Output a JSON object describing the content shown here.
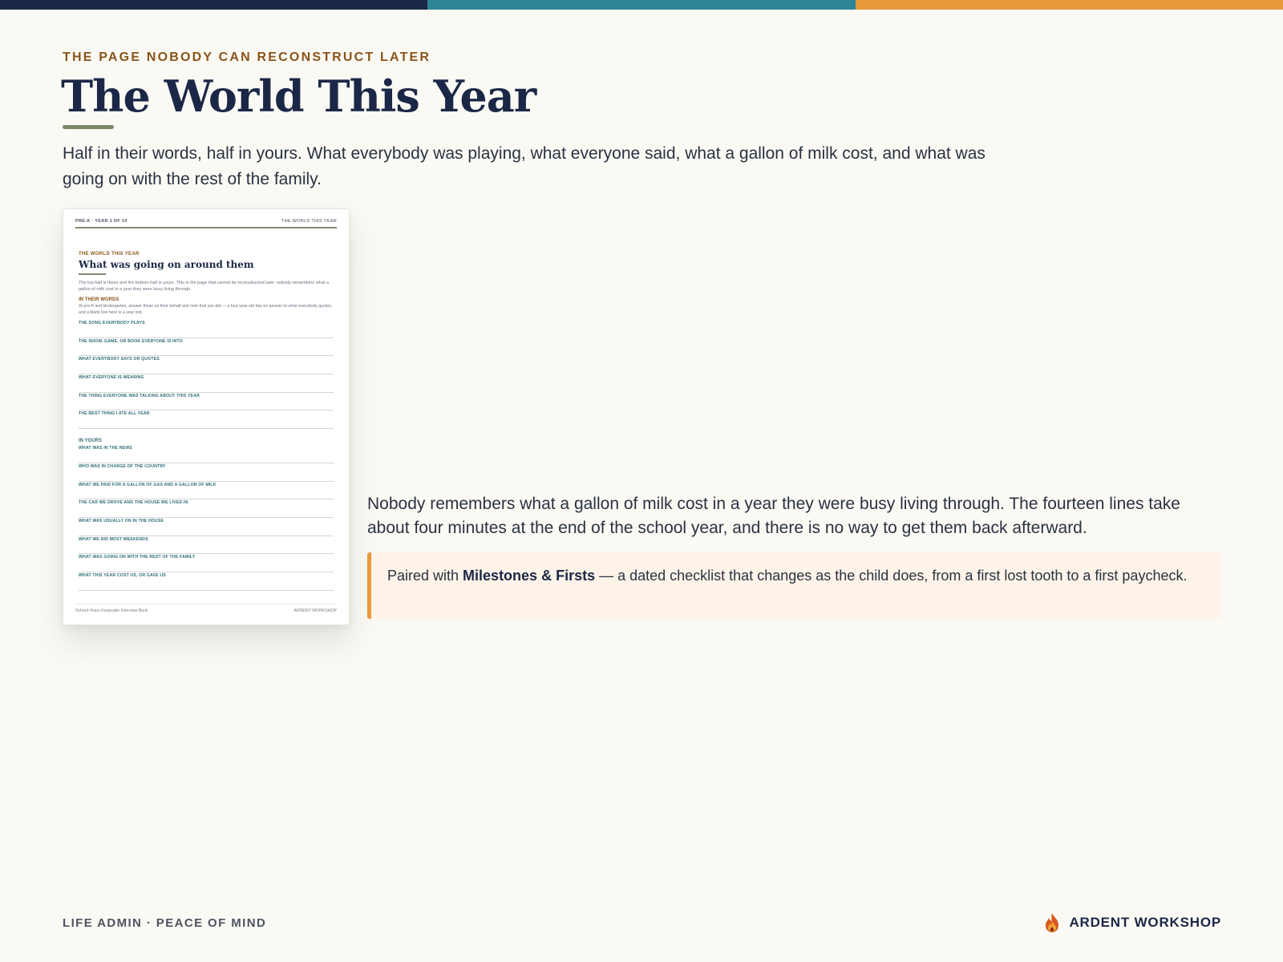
{
  "colors": {
    "bar_navy": "#1b2746",
    "bar_teal": "#2f8496",
    "bar_orange": "#e8993c",
    "kicker": "#8a5418",
    "accent_rule": "#7c8a6a"
  },
  "header": {
    "kicker": "THE PAGE NOBODY CAN RECONSTRUCT LATER",
    "title": "The World This Year",
    "lede": "Half in their words, half in yours. What everybody was playing, what everyone said, what a gallon of milk cost, and what was going on with the rest of the family."
  },
  "preview": {
    "top_left": "PRE-K · YEAR 1 OF 14",
    "top_right": "THE WORLD THIS YEAR",
    "kicker": "THE WORLD THIS YEAR",
    "title": "What was going on around them",
    "intro": "The top half is theirs and the bottom half is yours. This is the page that cannot be reconstructed later: nobody remembers what a gallon of milk cost in a year they were busy living through.",
    "section_theirs": "IN THEIR WORDS",
    "section_theirs_note": "At pre-K and kindergarten, answer these on their behalf and note that you did — a four-year-old has no answer to what everybody quotes, and a blank line here is a year lost.",
    "theirs_fields": [
      "THE SONG EVERYBODY PLAYS",
      "THE SHOW, GAME, OR BOOK EVERYONE IS INTO",
      "WHAT EVERYBODY SAYS OR QUOTES",
      "WHAT EVERYONE IS WEARING",
      "THE THING EVERYONE WAS TALKING ABOUT THIS YEAR",
      "THE BEST THING I ATE ALL YEAR"
    ],
    "section_yours": "IN YOURS",
    "yours_fields": [
      "WHAT WAS IN THE NEWS",
      "WHO WAS IN CHARGE OF THE COUNTRY",
      "WHAT WE PAID FOR A GALLON OF GAS AND A GALLON OF MILK",
      "THE CAR WE DROVE AND THE HOUSE WE LIVED IN",
      "WHAT WAS USUALLY ON IN THE HOUSE",
      "WHAT WE DID MOST WEEKENDS",
      "WHAT WAS GOING ON WITH THE REST OF THE FAMILY",
      "WHAT THIS YEAR COST US, OR GAVE US"
    ],
    "footer_left": "School-Years Keepsake Interview Book",
    "footer_right": "ARDENT WORKSHOP"
  },
  "body": {
    "paragraph": "Nobody remembers what a gallon of milk cost in a year they were busy living through. The fourteen lines take about four minutes at the end of the school year, and there is no way to get them back afterward.",
    "callout_prefix": "Paired with ",
    "callout_bold": "Milestones & Firsts",
    "callout_suffix": " — a dated checklist that changes as the child does, from a first lost tooth to a first paycheck."
  },
  "footer": {
    "tagline": "LIFE ADMIN · PEACE OF MIND",
    "brand": "ARDENT WORKSHOP",
    "brand_icon": "flame-icon"
  }
}
